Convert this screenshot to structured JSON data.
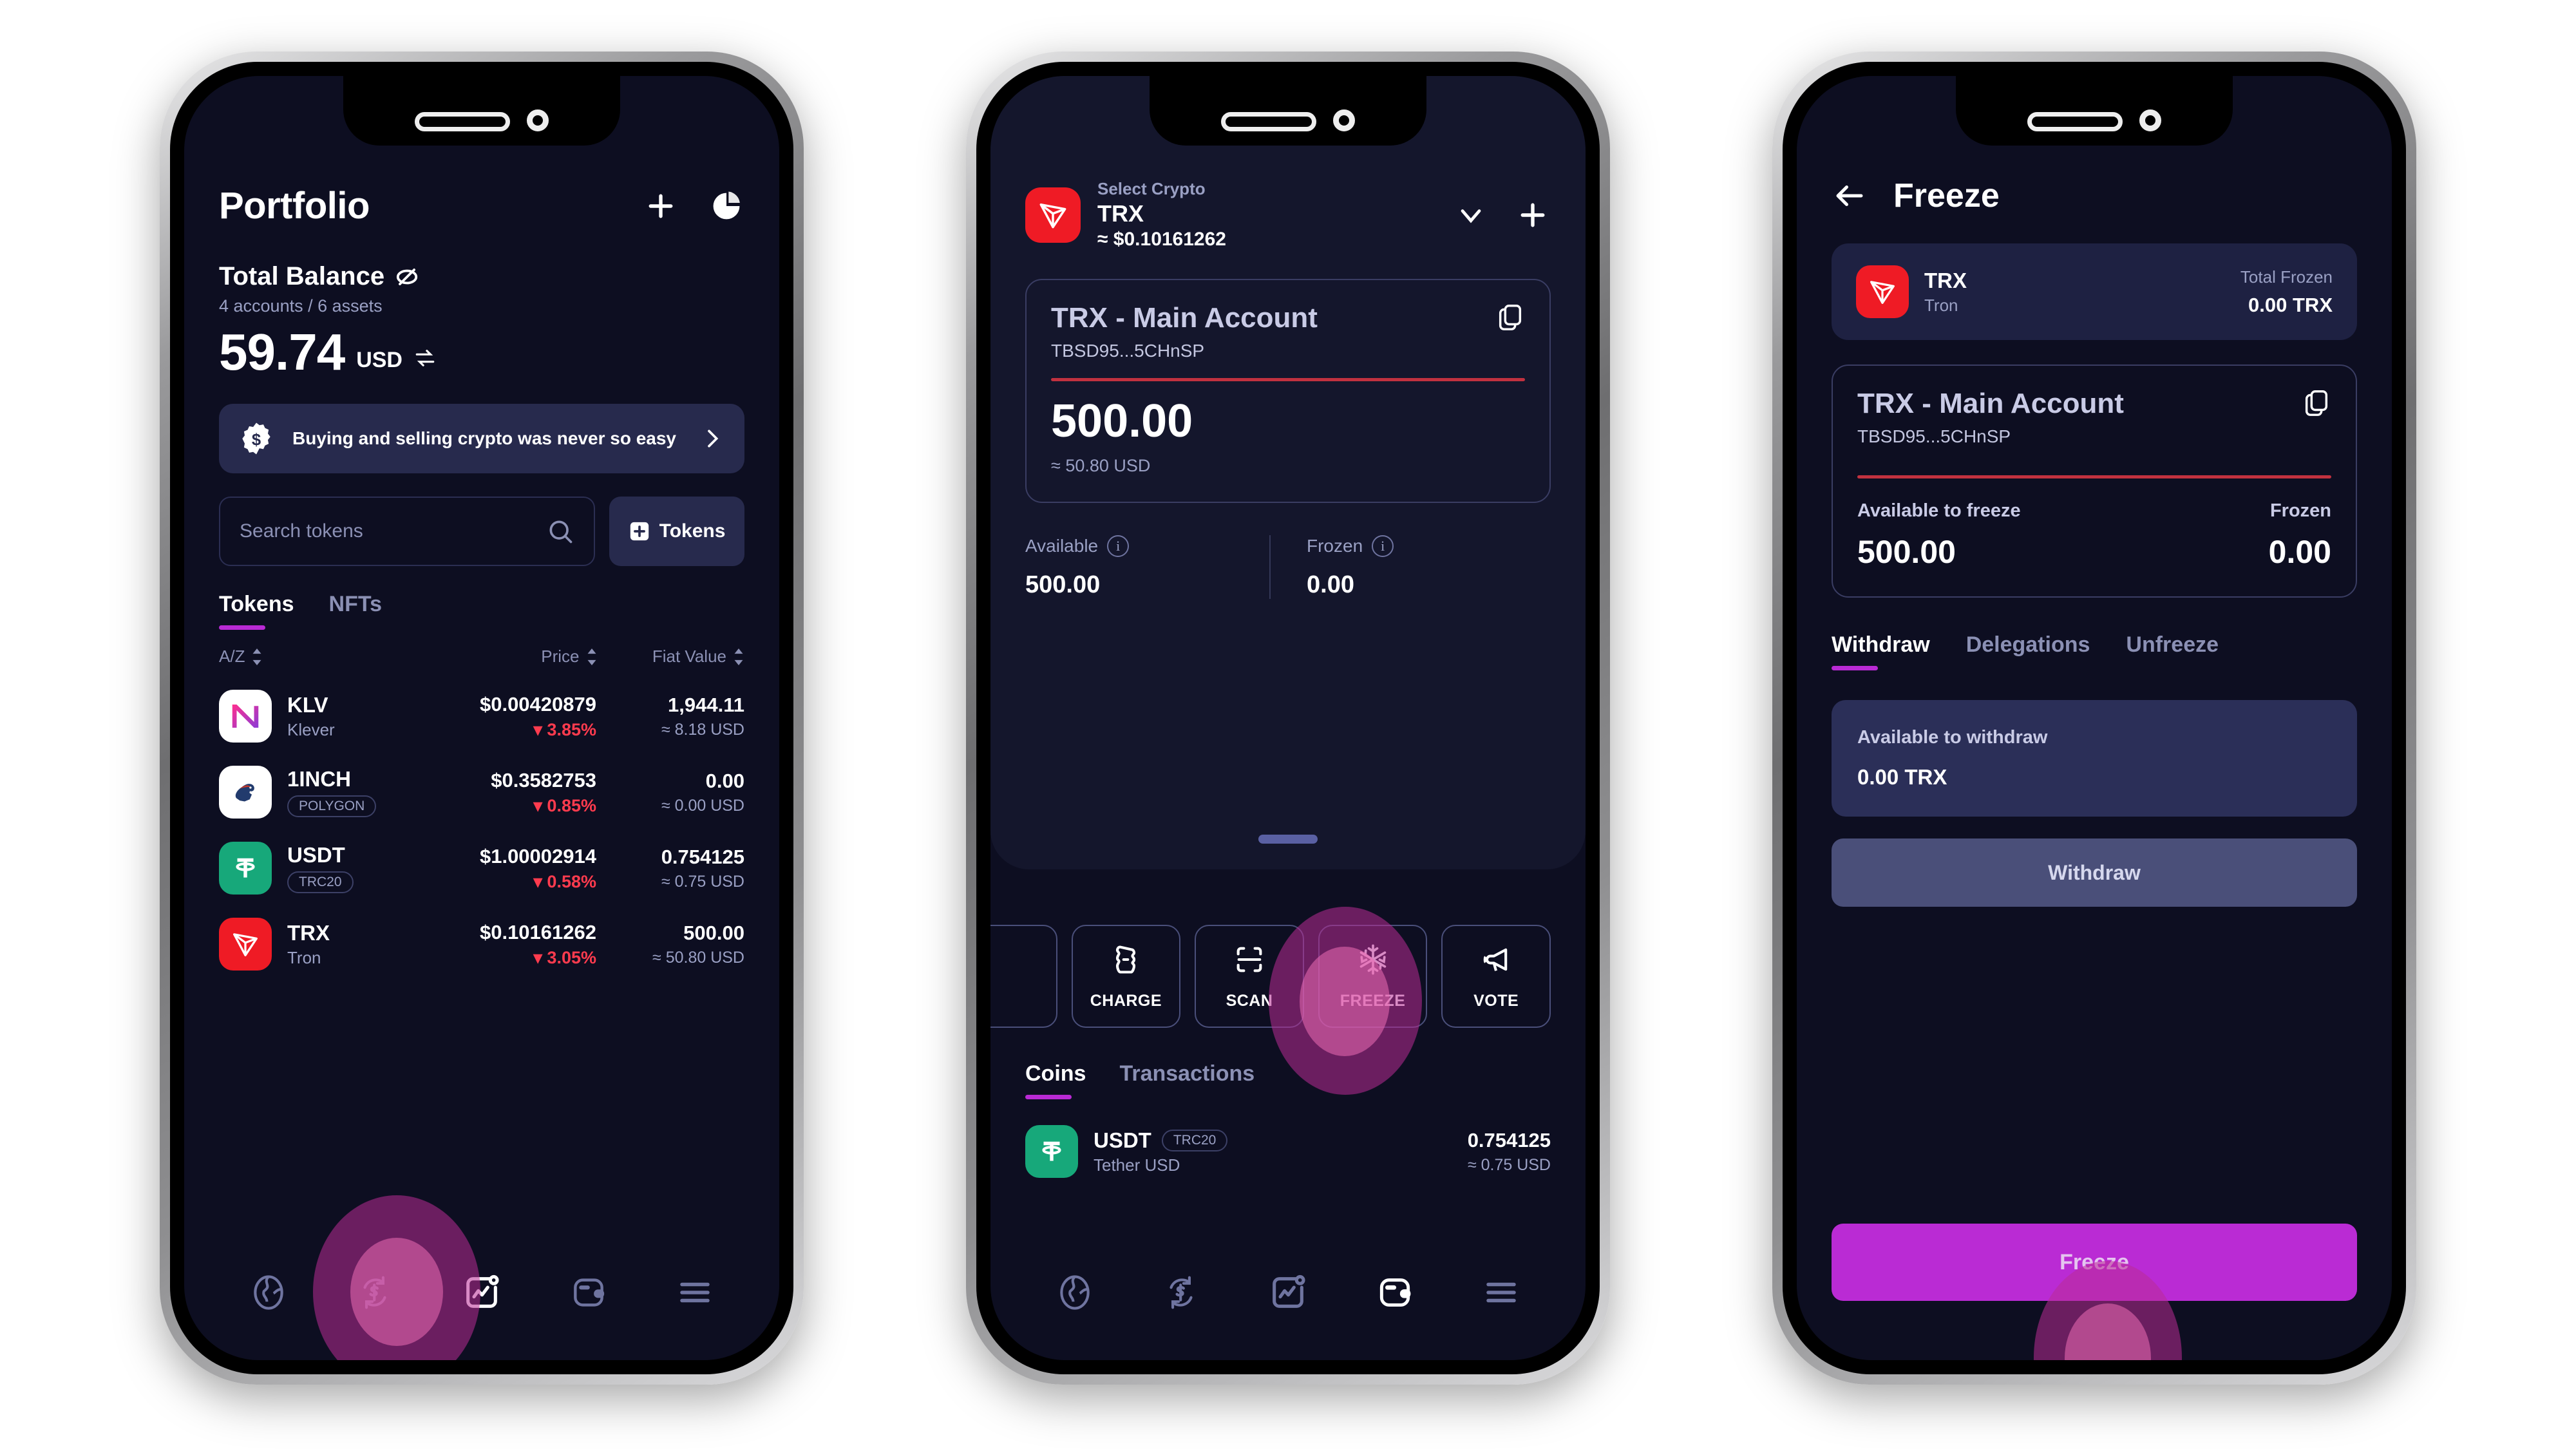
{
  "phone1": {
    "title": "Portfolio",
    "icons": {
      "add": "plus-icon",
      "chart": "pie-chart-icon"
    },
    "balance": {
      "label": "Total Balance",
      "eye_icon": "eye-off-icon",
      "subtitle": "4 accounts / 6 assets",
      "amount": "59.74",
      "currency": "USD",
      "swap_icon": "swap-icon"
    },
    "promo": {
      "icon": "dollar-badge-icon",
      "text": "Buying and selling crypto was never so easy",
      "chevron": "chevron-right-icon"
    },
    "search": {
      "placeholder": "Search tokens",
      "icon": "search-icon"
    },
    "tokens_button": {
      "label": "Tokens",
      "icon": "plus-square-icon"
    },
    "tabs": [
      {
        "label": "Tokens",
        "active": true
      },
      {
        "label": "NFTs",
        "active": false
      }
    ],
    "columns": {
      "name": "A/Z",
      "price": "Price",
      "fiat": "Fiat Value"
    },
    "rows": [
      {
        "symbol": "KLV",
        "name": "Klever",
        "chip": "",
        "price": "$0.00420879",
        "change": "▾ 3.85%",
        "fiat": "1,944.11",
        "fiat_usd": "≈ 8.18 USD",
        "logo": "klv-logo"
      },
      {
        "symbol": "1INCH",
        "name": "",
        "chip": "POLYGON",
        "price": "$0.3582753",
        "change": "▾ 0.85%",
        "fiat": "0.00",
        "fiat_usd": "≈ 0.00 USD",
        "logo": "1inch-logo"
      },
      {
        "symbol": "USDT",
        "name": "",
        "chip": "TRC20",
        "price": "$1.00002914",
        "change": "▾ 0.58%",
        "fiat": "0.754125",
        "fiat_usd": "≈ 0.75 USD",
        "logo": "usdt-logo"
      },
      {
        "symbol": "TRX",
        "name": "Tron",
        "chip": "",
        "price": "$0.10161262",
        "change": "▾ 3.05%",
        "fiat": "500.00",
        "fiat_usd": "≈ 50.80 USD",
        "logo": "trx-logo"
      }
    ],
    "nav": [
      {
        "icon": "globe-icon",
        "active": false
      },
      {
        "icon": "swap-dollar-icon",
        "active": false
      },
      {
        "icon": "portfolio-chart-icon",
        "active": true
      },
      {
        "icon": "wallet-icon",
        "active": false
      },
      {
        "icon": "menu-icon",
        "active": false
      }
    ]
  },
  "phone2": {
    "header": {
      "select_label": "Select Crypto",
      "symbol": "TRX",
      "price": "≈ $0.10161262",
      "chevron_icon": "chevron-down-icon",
      "plus_icon": "plus-icon"
    },
    "account_card": {
      "name": "TRX - Main Account",
      "address": "TBSD95...5CHnSP",
      "copy_icon": "copy-icon",
      "amount": "500.00",
      "usd": "≈ 50.80 USD"
    },
    "stats": [
      {
        "label": "Available",
        "value": "500.00",
        "info_icon": "info-icon"
      },
      {
        "label": "Frozen",
        "value": "0.00",
        "info_icon": "info-icon"
      }
    ],
    "actions": [
      {
        "label": "CHARGE",
        "icon": "charge-icon"
      },
      {
        "label": "SCAN",
        "icon": "scan-icon"
      },
      {
        "label": "FREEZE",
        "icon": "snowflake-icon"
      },
      {
        "label": "VOTE",
        "icon": "megaphone-icon"
      }
    ],
    "tabs": [
      {
        "label": "Coins",
        "active": true
      },
      {
        "label": "Transactions",
        "active": false
      }
    ],
    "coins": [
      {
        "symbol": "USDT",
        "chip": "TRC20",
        "name": "Tether USD",
        "amount": "0.754125",
        "usd": "≈ 0.75 USD",
        "logo": "usdt-logo"
      }
    ],
    "nav": [
      {
        "icon": "globe-icon",
        "active": false
      },
      {
        "icon": "swap-dollar-icon",
        "active": false
      },
      {
        "icon": "portfolio-chart-icon",
        "active": false
      },
      {
        "icon": "wallet-icon",
        "active": true
      },
      {
        "icon": "menu-icon",
        "active": false
      }
    ]
  },
  "phone3": {
    "header": {
      "back_icon": "arrow-left-icon",
      "title": "Freeze"
    },
    "asset_card": {
      "symbol": "TRX",
      "name": "Tron",
      "total_frozen_label": "Total Frozen",
      "total_frozen_value": "0.00 TRX",
      "logo": "trx-logo"
    },
    "account_card": {
      "name": "TRX - Main Account",
      "address": "TBSD95...5CHnSP",
      "copy_icon": "copy-icon",
      "available_label": "Available to freeze",
      "available_value": "500.00",
      "frozen_label": "Frozen",
      "frozen_value": "0.00"
    },
    "tabs": [
      {
        "label": "Withdraw",
        "active": true
      },
      {
        "label": "Delegations",
        "active": false
      },
      {
        "label": "Unfreeze",
        "active": false
      }
    ],
    "withdraw": {
      "label": "Available to withdraw",
      "value": "0.00 TRX",
      "button": "Withdraw"
    },
    "freeze_button": "Freeze"
  },
  "colors": {
    "screen_bg": "#0d0e21",
    "panel_bg": "#14162c",
    "accent_purple": "#b92ad4",
    "accent_magenta": "#ba2bd4",
    "danger_red": "#ff3b4e",
    "tron_red": "#ef1b25",
    "tether_green": "#17a87a",
    "muted": "#9aa0c4"
  }
}
